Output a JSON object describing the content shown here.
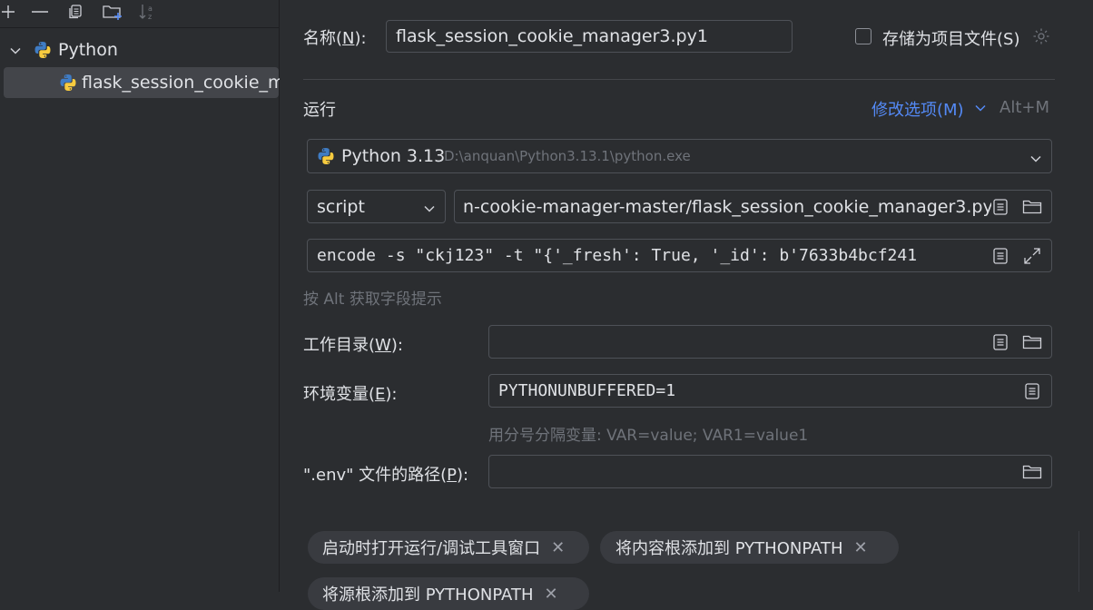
{
  "sidebar": {
    "toolbar": {
      "add_icon": "plus-icon",
      "remove_icon": "minus-icon",
      "copy_icon": "copy-icon",
      "new_folder_icon": "new-folder-icon",
      "sort_icon": "sort-alpha-icon"
    },
    "tree": {
      "group_label": "Python",
      "item_label": "flask_session_cookie_m"
    }
  },
  "form": {
    "name_label": "名称(",
    "name_key": "N",
    "name_label_end": "):",
    "name_value": "flask_session_cookie_manager3.py1",
    "store_label": "存储为项目文件(S)",
    "section_run": "运行",
    "modify_options": "修改选项(M)",
    "modify_shortcut": "Alt+M",
    "interpreter_name": "Python 3.13",
    "interpreter_path": "D:\\anquan\\Python3.13.1\\python.exe",
    "script_type": "script",
    "script_path": "n-cookie-manager-master/flask_session_cookie_manager3.py",
    "params": "encode -s \"ckj123\" -t \"{'_fresh': True, '_id': b'7633b4bcf241",
    "alt_hint": "按 Alt 获取字段提示",
    "workdir_label_a": "工作目录(",
    "workdir_key": "W",
    "workdir_label_b": "):",
    "workdir_value": "",
    "env_label_a": "环境变量(",
    "env_key": "E",
    "env_label_b": "):",
    "env_value": "PYTHONUNBUFFERED=1",
    "env_hint": "用分号分隔变量: VAR=value; VAR1=value1",
    "dotenv_label_a": "\".env\" 文件的路径(",
    "dotenv_key": "P",
    "dotenv_label_b": "):",
    "dotenv_value": "",
    "chips": [
      "启动时打开运行/调试工具窗口",
      "将内容根添加到 PYTHONPATH",
      "将源根添加到 PYTHONPATH"
    ]
  },
  "colors": {
    "accent_link": "#548af7",
    "background": "#2b2d30"
  }
}
